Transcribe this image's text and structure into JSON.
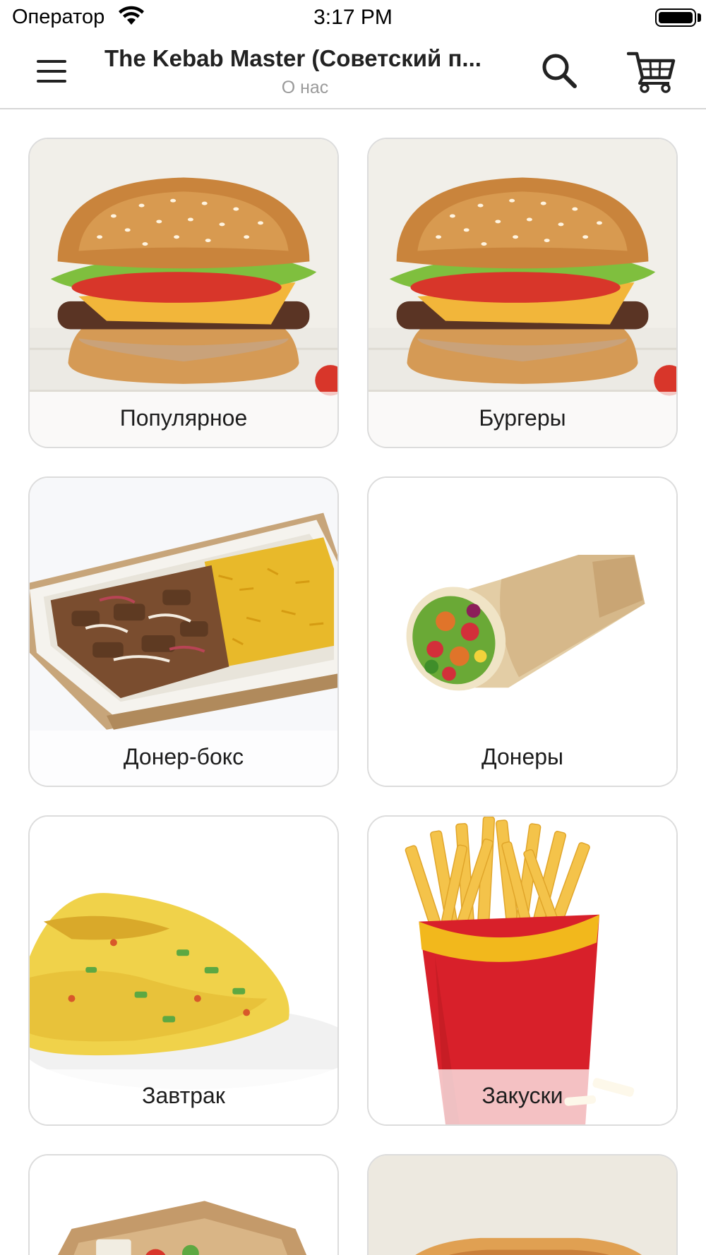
{
  "status_bar": {
    "carrier": "Оператор",
    "time": "3:17 PM",
    "wifi_icon": "wifi-icon",
    "battery_icon": "battery-icon"
  },
  "nav_bar": {
    "title": "The Kebab Master (Советский п...",
    "subtitle": "О нас",
    "menu_icon": "hamburger-menu-icon",
    "search_icon": "search-icon",
    "cart_icon": "shopping-cart-icon"
  },
  "categories": [
    {
      "label": "Популярное",
      "image": "burger"
    },
    {
      "label": "Бургеры",
      "image": "burger"
    },
    {
      "label": "Донер-бокс",
      "image": "doner-box"
    },
    {
      "label": "Донеры",
      "image": "doner-wrap"
    },
    {
      "label": "Завтрак",
      "image": "omelette"
    },
    {
      "label": "Закуски",
      "image": "french-fries"
    }
  ],
  "colors": {
    "card_border": "#dcdcdc",
    "subtitle": "#9a9a9a",
    "fries_box_red": "#d8202a",
    "fries_box_yellow": "#f2b81c"
  }
}
